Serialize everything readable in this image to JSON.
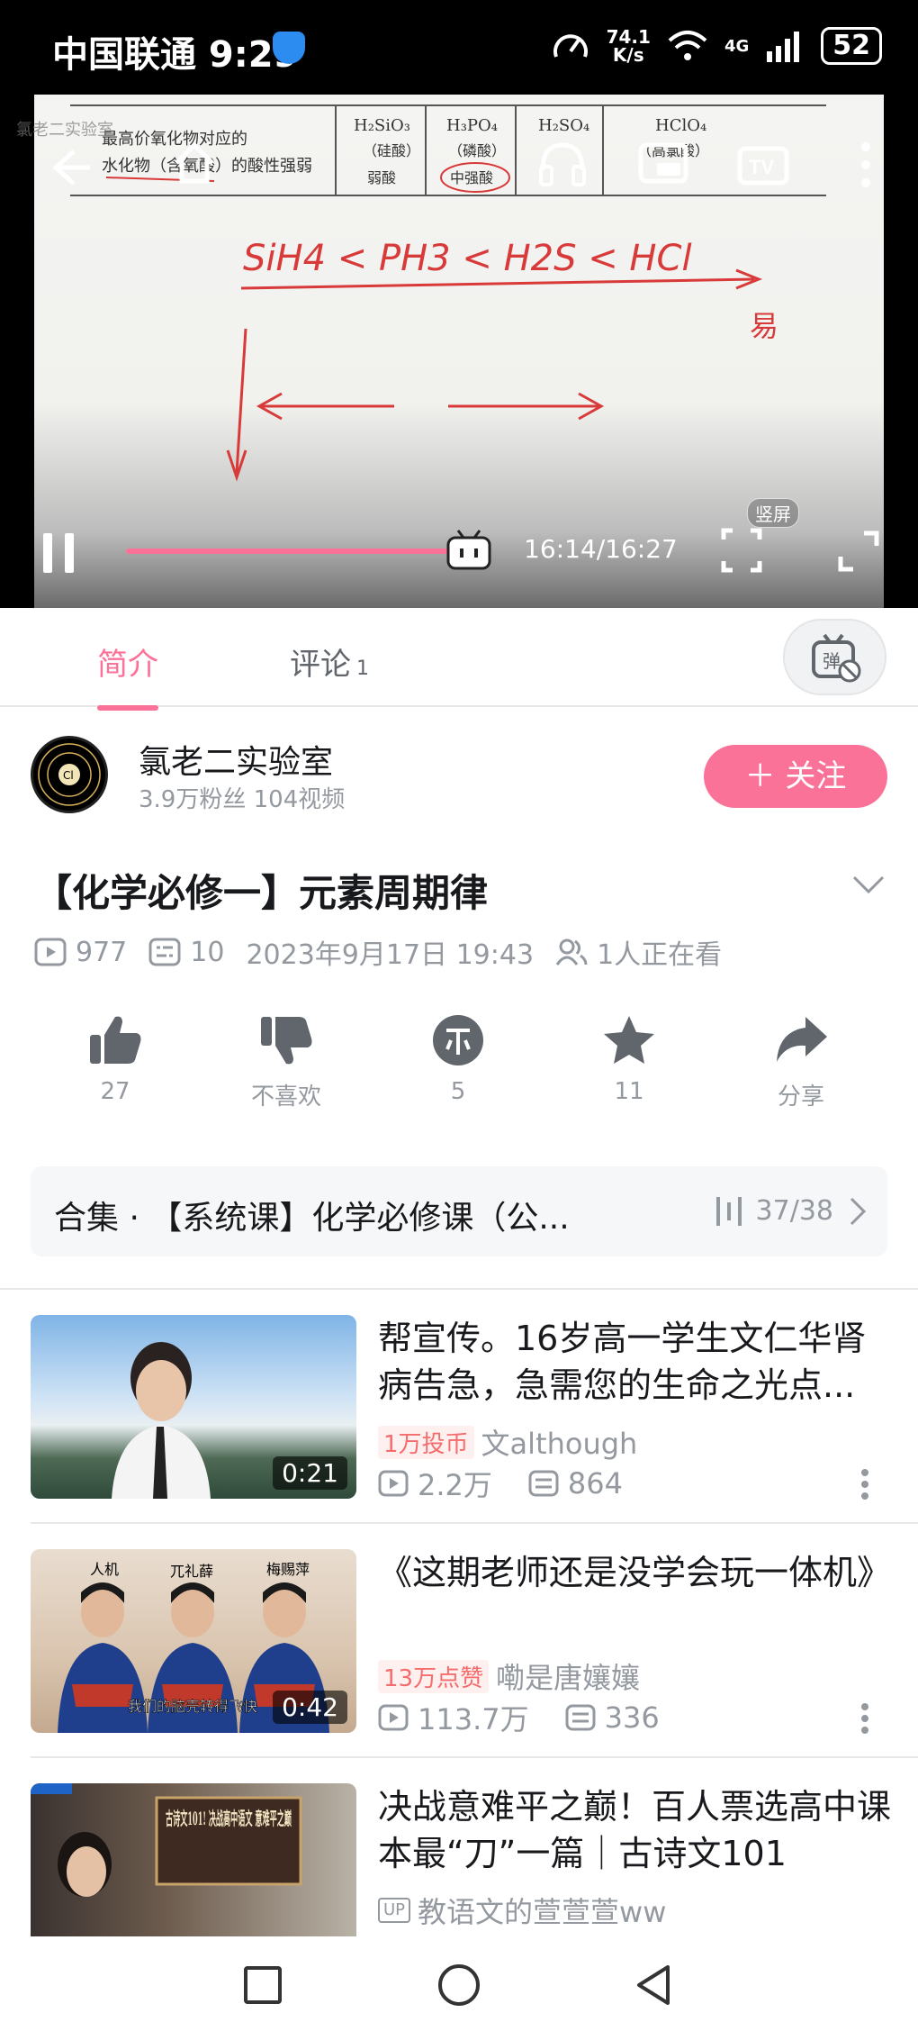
{
  "status": {
    "carrier": "中国联通 9:29",
    "net_speed_value": "74.1",
    "net_speed_unit": "K/s",
    "network": "4G",
    "battery": "52"
  },
  "video": {
    "time": "16:14/16:27",
    "progress_fraction": 0.981,
    "portrait_label": "竖屏",
    "handwriting": "SiH4 < PH3 < H2S < HCl",
    "easy_label": "易",
    "watermark": "氯老二实验室"
  },
  "tabs": {
    "intro": "简介",
    "comments": "评论",
    "comments_count": "1"
  },
  "uploader": {
    "name": "氯老二实验室",
    "stats": "3.9万粉丝   104视频",
    "follow_label": "＋ 关注"
  },
  "title": "【化学必修一】元素周期律",
  "meta": {
    "plays": "977",
    "danmaku": "10",
    "date": "2023年9月17日 19:43",
    "watching": "1人正在看"
  },
  "actions": {
    "like": "27",
    "dislike": "不喜欢",
    "coin": "5",
    "favorite": "11",
    "share": "分享"
  },
  "collection": {
    "title": "合集 · 【系统课】化学必修课（公...",
    "progress": "37/38"
  },
  "recommendations": [
    {
      "title": "帮宣传。16岁高一学生文仁华肾病告急，急需您的生命之光点...",
      "duration": "0:21",
      "badge": "1万投币",
      "author": "文although",
      "plays": "2.2万",
      "danmaku": "864"
    },
    {
      "title": "《这期老师还是没学会玩一体机》",
      "duration": "0:42",
      "badge": "13万点赞",
      "author": "嘞是唐孃孃",
      "plays": "113.7万",
      "danmaku": "336",
      "thumb_labels": [
        "人机",
        "兀礼薛",
        "梅赐萍"
      ],
      "thumb_caption": "我们的脑壳转得飞快"
    },
    {
      "title": "决战意难平之巅！百人票选高中课本最“刀”一篇｜古诗文101",
      "up_badge": "UP",
      "author": "教语文的萱萱萱ww",
      "thumb_text": "古诗文101! 决战高中语文 意难平之巅"
    }
  ]
}
